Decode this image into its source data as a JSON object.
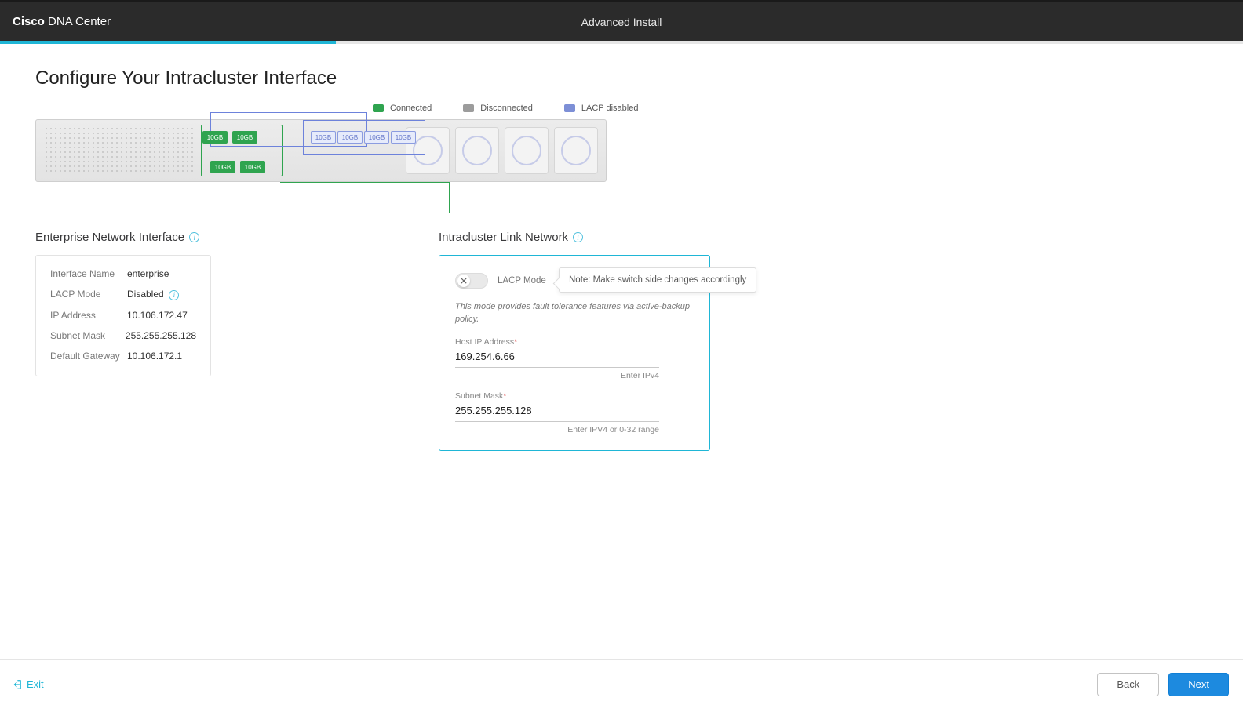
{
  "header": {
    "brand_bold": "Cisco",
    "brand_light": " DNA Center",
    "title": "Advanced Install"
  },
  "page": {
    "heading": "Configure Your Intracluster Interface"
  },
  "legend": {
    "connected": "Connected",
    "disconnected": "Disconnected",
    "lacp_disabled": "LACP disabled"
  },
  "ports": {
    "label": "10GB"
  },
  "enterprise": {
    "section_title": "Enterprise Network Interface",
    "fields": {
      "interface_name_k": "Interface Name",
      "interface_name_v": "enterprise",
      "lacp_mode_k": "LACP Mode",
      "lacp_mode_v": "Disabled",
      "ip_k": "IP Address",
      "ip_v": "10.106.172.47",
      "mask_k": "Subnet Mask",
      "mask_v": "255.255.255.128",
      "gw_k": "Default Gateway",
      "gw_v": "10.106.172.1"
    }
  },
  "intracluster": {
    "section_title": "Intracluster Link Network",
    "lacp_label": "LACP Mode",
    "tooltip": "Note: Make switch side changes accordingly",
    "mode_desc": "This mode provides fault tolerance features via active-backup policy.",
    "host_ip_label": "Host IP Address",
    "host_ip_value": "169.254.6.66",
    "host_ip_hint": "Enter IPv4",
    "mask_label": "Subnet Mask",
    "mask_value": "255.255.255.128",
    "mask_hint": "Enter IPV4 or 0-32 range"
  },
  "footer": {
    "exit": "Exit",
    "back": "Back",
    "next": "Next"
  }
}
